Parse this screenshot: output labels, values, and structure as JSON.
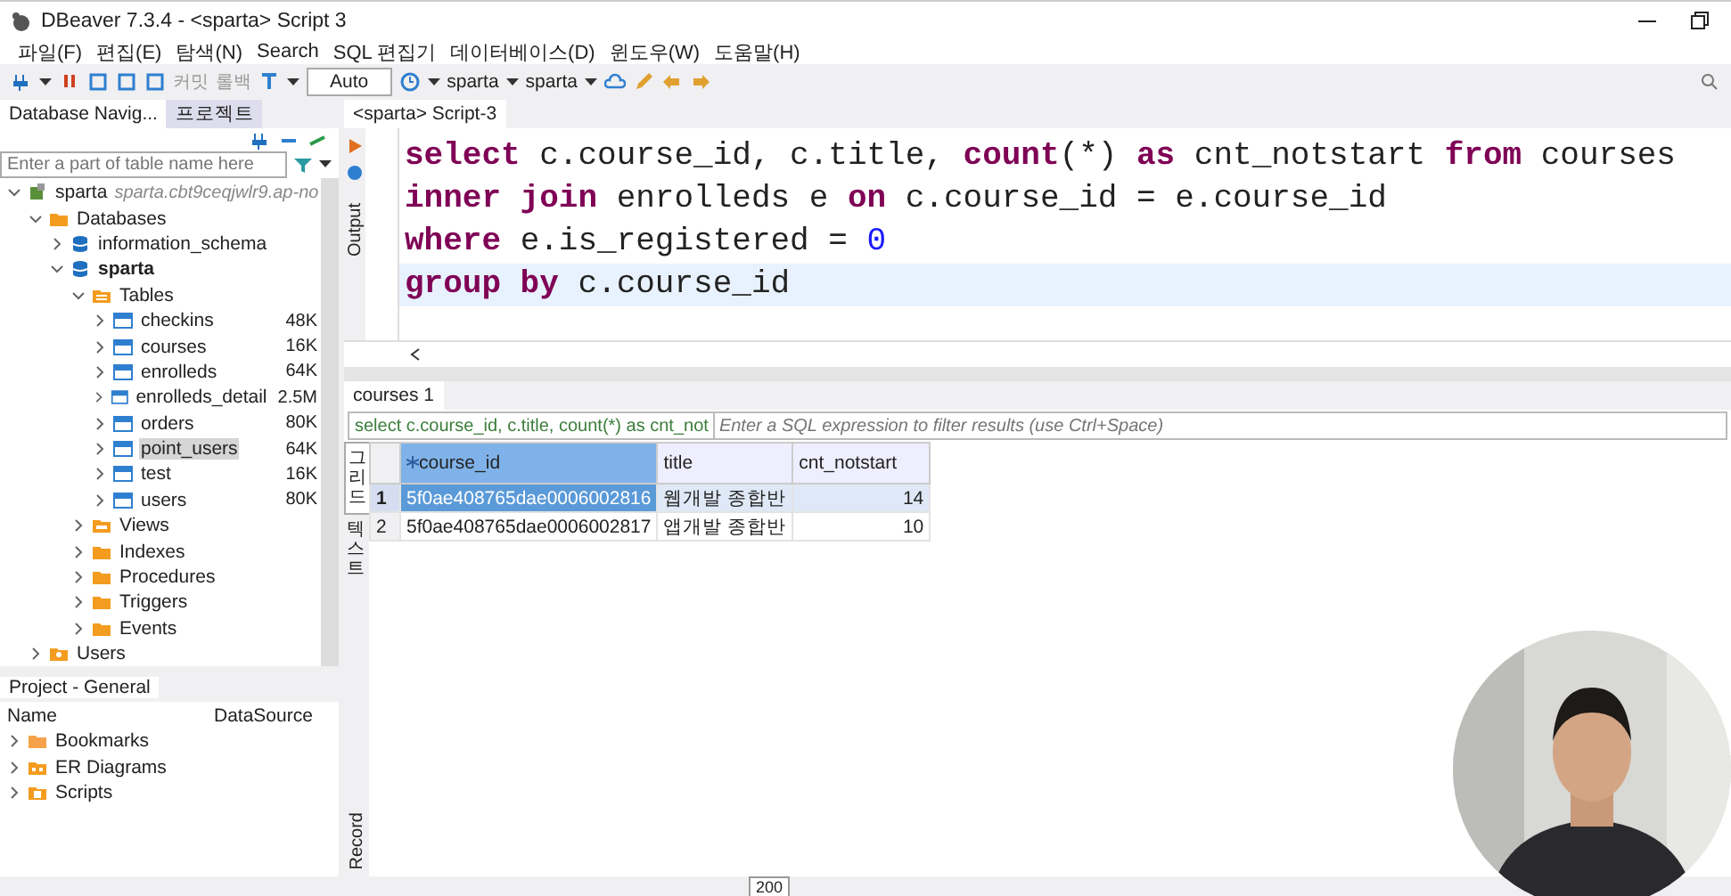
{
  "window": {
    "title": "DBeaver 7.3.4 - <sparta> Script 3"
  },
  "menu": [
    "파일(F)",
    "편집(E)",
    "탐색(N)",
    "Search",
    "SQL 편집기",
    "데이터베이스(D)",
    "윈도우(W)",
    "도움말(H)"
  ],
  "toolbar": {
    "commit": {
      "label": "커밋",
      "disabled": true
    },
    "rollback": {
      "label": "롤백",
      "disabled": true
    },
    "transaction_mode": "Auto",
    "datasource": "sparta",
    "schema": "sparta"
  },
  "navigator": {
    "tabs": [
      {
        "label": "Database Navig...",
        "selected": true
      },
      {
        "label": "프로젝트",
        "selected": false
      }
    ],
    "filter": {
      "placeholder": "Enter a part of table name here"
    },
    "tree": [
      {
        "label": "sparta",
        "note": "sparta.cbt9ceqjwlr9.ap-no",
        "kind": "connection",
        "expanded": true,
        "selected": false,
        "children": [
          {
            "label": "Databases",
            "kind": "folder",
            "expanded": true,
            "selected": false,
            "children": [
              {
                "label": "information_schema",
                "kind": "database",
                "expanded": false,
                "selected": false
              },
              {
                "label": "sparta",
                "kind": "database",
                "bold": true,
                "expanded": true,
                "selected": false,
                "children": [
                  {
                    "label": "Tables",
                    "kind": "tables",
                    "expanded": true,
                    "selected": false,
                    "children": [
                      {
                        "label": "checkins",
                        "size": "48K",
                        "kind": "table",
                        "expanded": false,
                        "selected": false
                      },
                      {
                        "label": "courses",
                        "size": "16K",
                        "kind": "table",
                        "expanded": false,
                        "selected": false
                      },
                      {
                        "label": "enrolleds",
                        "size": "64K",
                        "kind": "table",
                        "expanded": false,
                        "selected": false
                      },
                      {
                        "label": "enrolleds_detail",
                        "size": "2.5M",
                        "kind": "table",
                        "expanded": false,
                        "selected": false
                      },
                      {
                        "label": "orders",
                        "size": "80K",
                        "kind": "table",
                        "expanded": false,
                        "selected": false
                      },
                      {
                        "label": "point_users",
                        "size": "64K",
                        "kind": "table",
                        "expanded": false,
                        "selected": true
                      },
                      {
                        "label": "test",
                        "size": "16K",
                        "kind": "table",
                        "expanded": false,
                        "selected": false
                      },
                      {
                        "label": "users",
                        "size": "80K",
                        "kind": "table",
                        "expanded": false,
                        "selected": false
                      }
                    ]
                  },
                  {
                    "label": "Views",
                    "kind": "views",
                    "expanded": false,
                    "selected": false
                  },
                  {
                    "label": "Indexes",
                    "kind": "folder",
                    "expanded": false,
                    "selected": false
                  },
                  {
                    "label": "Procedures",
                    "kind": "folder",
                    "expanded": false,
                    "selected": false
                  },
                  {
                    "label": "Triggers",
                    "kind": "folder",
                    "expanded": false,
                    "selected": false
                  },
                  {
                    "label": "Events",
                    "kind": "folder",
                    "expanded": false,
                    "selected": false
                  }
                ]
              }
            ]
          },
          {
            "label": "Users",
            "kind": "users",
            "expanded": false,
            "selected": false
          }
        ]
      }
    ]
  },
  "project": {
    "title": "Project - General",
    "columns": [
      "Name",
      "DataSource"
    ],
    "items": [
      {
        "label": "Bookmarks",
        "kind": "bookmarks"
      },
      {
        "label": "ER Diagrams",
        "kind": "diagrams"
      },
      {
        "label": "Scripts",
        "kind": "scripts"
      }
    ]
  },
  "editor": {
    "tab": "<sparta> Script-3",
    "side_label": "Output",
    "lines": [
      {
        "current": false,
        "tokens": [
          {
            "kind": "keyword",
            "text": "select"
          },
          {
            "kind": "plain",
            "text": " c.course_id, c.title, "
          },
          {
            "kind": "keyword",
            "text": "count"
          },
          {
            "kind": "plain",
            "text": "(*) "
          },
          {
            "kind": "keyword",
            "text": "as"
          },
          {
            "kind": "plain",
            "text": " cnt_notstart "
          },
          {
            "kind": "keyword",
            "text": "from"
          },
          {
            "kind": "plain",
            "text": " courses"
          }
        ]
      },
      {
        "current": false,
        "tokens": [
          {
            "kind": "keyword",
            "text": "inner join"
          },
          {
            "kind": "plain",
            "text": " enrolleds e "
          },
          {
            "kind": "keyword",
            "text": "on"
          },
          {
            "kind": "plain",
            "text": " c.course_id = e.course_id"
          }
        ]
      },
      {
        "current": false,
        "tokens": [
          {
            "kind": "keyword",
            "text": "where"
          },
          {
            "kind": "plain",
            "text": " e.is_registered = "
          },
          {
            "kind": "number",
            "text": "0"
          }
        ]
      },
      {
        "current": true,
        "tokens": [
          {
            "kind": "keyword",
            "text": "group by"
          },
          {
            "kind": "plain",
            "text": " c.course_id"
          }
        ]
      }
    ]
  },
  "results": {
    "tab": "courses 1",
    "query": "select c.course_id, c.title, count(*) as cnt_not",
    "filter": {
      "placeholder": "Enter a SQL expression to filter results (use Ctrl+Space)"
    },
    "view_tabs": [
      {
        "label": "그리드",
        "selected": true
      },
      {
        "label": "텍스트",
        "selected": false
      }
    ],
    "record_label": "Record",
    "columns": [
      {
        "label": "course_id",
        "kind": "key"
      },
      {
        "label": "title",
        "kind": "text"
      },
      {
        "label": "cnt_notstart",
        "kind": "number"
      }
    ],
    "rows": [
      {
        "number": "1",
        "selected": true,
        "cells": [
          "5f0ae408765dae0006002816",
          "웹개발 종합반",
          "14"
        ]
      },
      {
        "number": "2",
        "selected": false,
        "cells": [
          "5f0ae408765dae0006002817",
          "앱개발 종합반",
          "10"
        ]
      }
    ],
    "page_size": "200"
  }
}
